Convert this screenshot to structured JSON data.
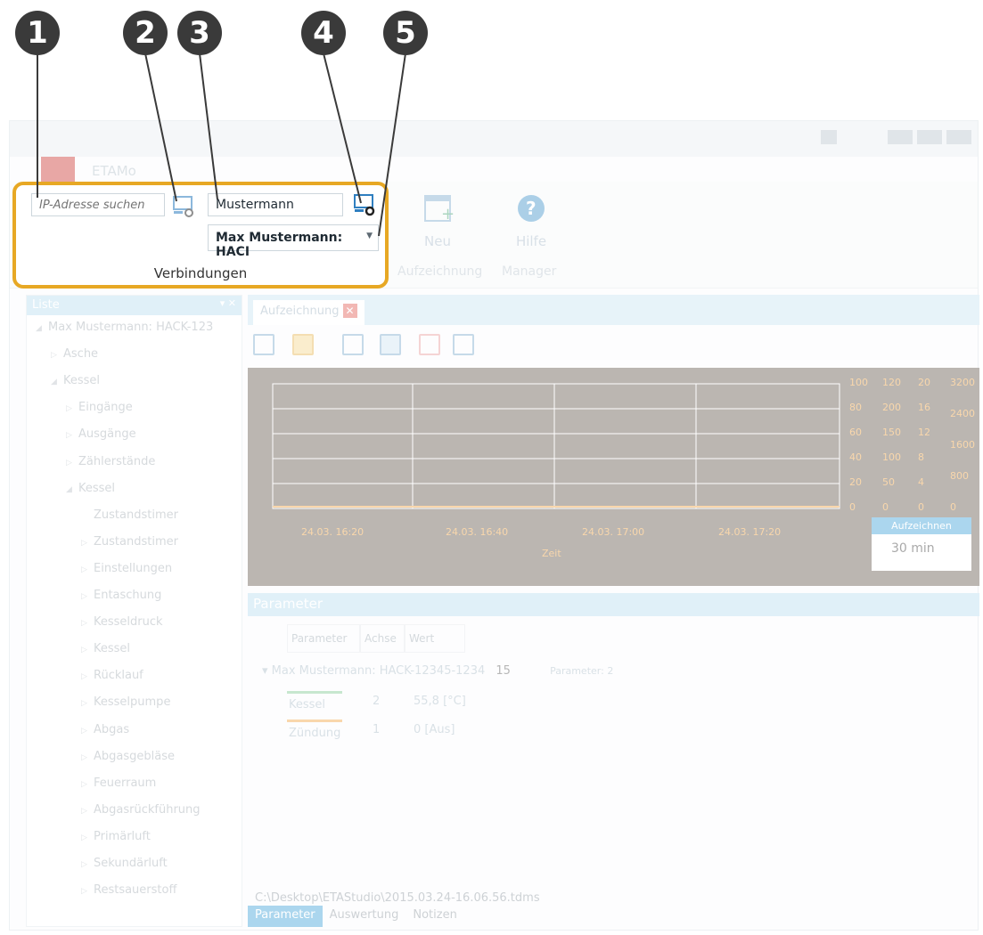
{
  "callouts": [
    "1",
    "2",
    "3",
    "4",
    "5"
  ],
  "app": {
    "title": "ETAMo"
  },
  "ribbon": {
    "neu_label": "Neu",
    "hilfe_label": "Hilfe",
    "group_aufzeichnung": "Aufzeichnung",
    "group_manager": "Manager"
  },
  "connections": {
    "ip_placeholder": "IP-Adresse suchen",
    "user_value": "Mustermann",
    "select_value": "Max Mustermann: HACI",
    "group_label": "Verbindungen"
  },
  "list_panel": {
    "title": "Liste",
    "items": [
      {
        "label": "Max Mustermann: HACK-123",
        "level": 0,
        "marker": "open"
      },
      {
        "label": "Asche",
        "level": 1,
        "marker": "closed"
      },
      {
        "label": "Kessel",
        "level": 1,
        "marker": "open"
      },
      {
        "label": "Eingänge",
        "level": 2,
        "marker": "closed"
      },
      {
        "label": "Ausgänge",
        "level": 2,
        "marker": "closed"
      },
      {
        "label": "Zählerstände",
        "level": 2,
        "marker": "closed"
      },
      {
        "label": "Kessel",
        "level": 2,
        "marker": "open"
      },
      {
        "label": "Zustandstimer",
        "level": 3,
        "marker": "none"
      },
      {
        "label": "Zustandstimer",
        "level": 3,
        "marker": "closed"
      },
      {
        "label": "Einstellungen",
        "level": 3,
        "marker": "closed"
      },
      {
        "label": "Entaschung",
        "level": 3,
        "marker": "closed"
      },
      {
        "label": "Kesseldruck",
        "level": 3,
        "marker": "closed"
      },
      {
        "label": "Kessel",
        "level": 3,
        "marker": "closed"
      },
      {
        "label": "Rücklauf",
        "level": 3,
        "marker": "closed"
      },
      {
        "label": "Kesselpumpe",
        "level": 3,
        "marker": "closed"
      },
      {
        "label": "Abgas",
        "level": 3,
        "marker": "closed"
      },
      {
        "label": "Abgasgebläse",
        "level": 3,
        "marker": "closed"
      },
      {
        "label": "Feuerraum",
        "level": 3,
        "marker": "closed"
      },
      {
        "label": "Abgasrückführung",
        "level": 3,
        "marker": "closed"
      },
      {
        "label": "Primärluft",
        "level": 3,
        "marker": "closed"
      },
      {
        "label": "Sekundärluft",
        "level": 3,
        "marker": "closed"
      },
      {
        "label": "Restsauerstoff",
        "level": 3,
        "marker": "closed"
      }
    ]
  },
  "document": {
    "tab_label": "Aufzeichnung",
    "chart_x_ticks": [
      "24.03. 16:20",
      "24.03. 16:40",
      "24.03. 17:00",
      "24.03. 17:20"
    ],
    "chart_xlabel": "Zeit",
    "chart_y_axes": [
      [
        "100",
        "80",
        "60",
        "40",
        "20",
        "0"
      ],
      [
        "120",
        "200",
        "150",
        "100",
        "50",
        "0"
      ],
      [
        "20",
        "16",
        "12",
        "8",
        "4",
        "0"
      ],
      [
        "3200",
        "2400",
        "1600",
        "800",
        "0"
      ]
    ],
    "window_label": "Aufzeichnen",
    "window_value": "30 min"
  },
  "parameter_panel": {
    "title": "Parameter",
    "columns": [
      "Parameter",
      "Achse",
      "Wert"
    ],
    "device": "Max Mustermann: HACK-12345-1234",
    "device_rate": "15",
    "param_count": "Parameter: 2",
    "rows": [
      {
        "name": "Kessel",
        "axis": "2",
        "value": "55,8 [°C]",
        "color": "#7cc78f"
      },
      {
        "name": "Zündung",
        "axis": "1",
        "value": "0 [Aus]",
        "color": "#f2a23b"
      }
    ]
  },
  "status": {
    "path": "C:\\Desktop\\ETAStudio\\2015.03.24-16.06.56.tdms"
  },
  "bottom_tabs": [
    "Parameter",
    "Auswertung",
    "Notizen"
  ]
}
